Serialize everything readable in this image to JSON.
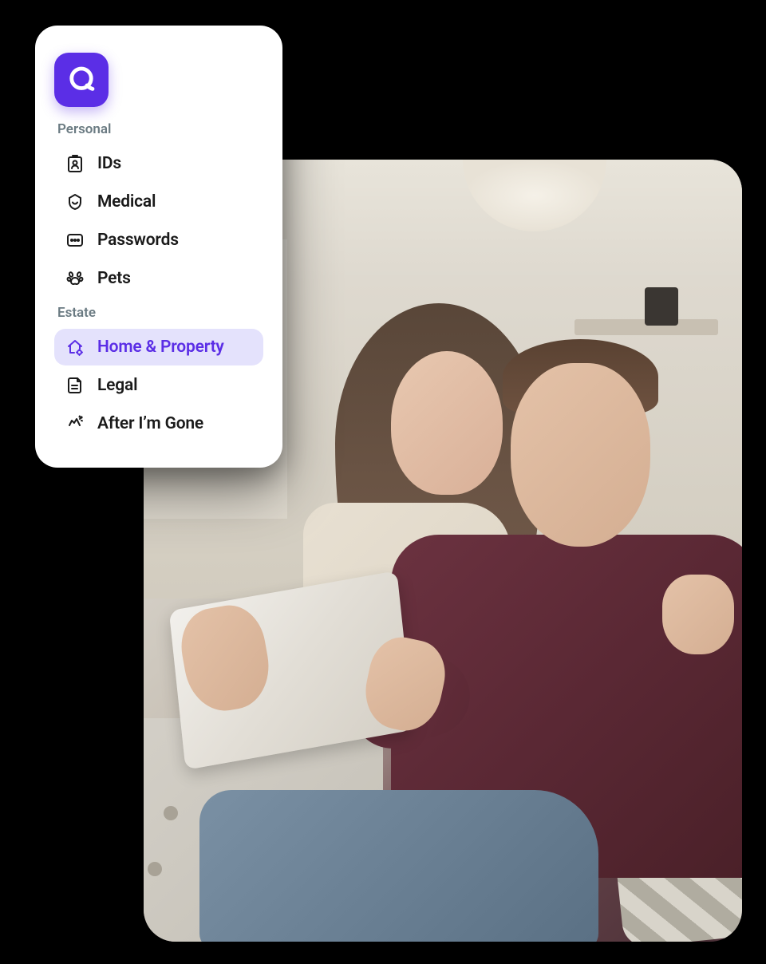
{
  "brand": {
    "accent_color": "#5b2ee6",
    "active_bg": "#e4e2fc"
  },
  "sidebar": {
    "sections": [
      {
        "label": "Personal",
        "items": [
          {
            "icon": "id-icon",
            "label": "IDs",
            "active": false
          },
          {
            "icon": "medical-icon",
            "label": "Medical",
            "active": false
          },
          {
            "icon": "passwords-icon",
            "label": "Passwords",
            "active": false
          },
          {
            "icon": "pets-icon",
            "label": "Pets",
            "active": false
          }
        ]
      },
      {
        "label": "Estate",
        "items": [
          {
            "icon": "home-icon",
            "label": "Home & Property",
            "active": true
          },
          {
            "icon": "legal-icon",
            "label": "Legal",
            "active": false
          },
          {
            "icon": "after-gone-icon",
            "label": "After I’m Gone",
            "active": false
          }
        ]
      }
    ]
  }
}
